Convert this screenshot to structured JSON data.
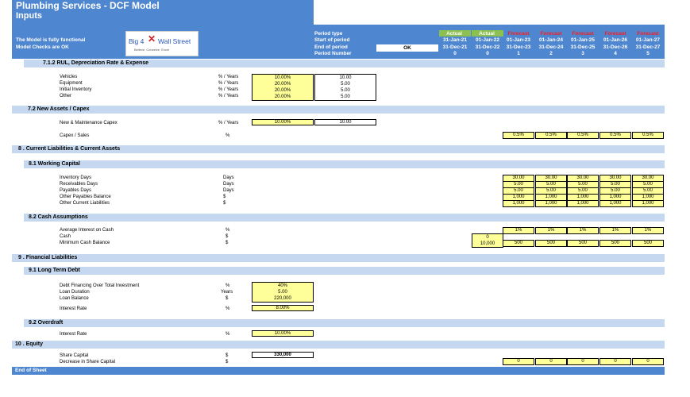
{
  "app": {
    "title": "Plumbing Services - DCF Model",
    "sheet": "Inputs",
    "status_line1": "The Model is fully functional",
    "status_line2": "Model Checks are OK",
    "ok_label": "OK",
    "logo": {
      "left": "Big 4",
      "right": "Wall Street",
      "tagline": "Believe, Conceive, Excel"
    }
  },
  "header": {
    "row_labels": [
      "Period type",
      "Start of period",
      "End of period",
      "Period Number"
    ],
    "columns": [
      {
        "type": "Actual",
        "start": "31-Jan-21",
        "end": "31-Dec-21",
        "num": "0"
      },
      {
        "type": "Actual",
        "start": "01-Jan-22",
        "end": "31-Dec-22",
        "num": "0"
      },
      {
        "type": "Forecast",
        "start": "01-Jan-23",
        "end": "31-Dec-23",
        "num": "1"
      },
      {
        "type": "Forecast",
        "start": "01-Jan-24",
        "end": "31-Dec-24",
        "num": "2"
      },
      {
        "type": "Forecast",
        "start": "01-Jan-25",
        "end": "31-Dec-25",
        "num": "3"
      },
      {
        "type": "Forecast",
        "start": "01-Jan-26",
        "end": "31-Dec-26",
        "num": "4"
      },
      {
        "type": "Forecast",
        "start": "01-Jan-27",
        "end": "31-Dec-27",
        "num": "5"
      }
    ]
  },
  "sections": {
    "s712": "7.1.2 RUL, Depreciation Rate & Expense",
    "s72": "7.2  New Assets / Capex",
    "s8": "8 . Current Liabilities & Current Assets",
    "s81": "8.1  Working Capital",
    "s82": "8.2  Cash Assumptions",
    "s9": "9 . Financial Liabilities",
    "s91": "9.1  Long Term Debt",
    "s92": "9.2  Overdraft",
    "s10": "10 . Equity"
  },
  "depreciation": {
    "rows": [
      {
        "label": "Vehicles",
        "unit": "% / Years",
        "rate": "10.00%",
        "years": "10.00"
      },
      {
        "label": "Equipment",
        "unit": "% / Years",
        "rate": "20.00%",
        "years": "5.00"
      },
      {
        "label": "Initial Inventory",
        "unit": "% / Years",
        "rate": "20.00%",
        "years": "5.00"
      },
      {
        "label": "Other",
        "unit": "% / Years",
        "rate": "20.00%",
        "years": "5.00"
      }
    ]
  },
  "capex": {
    "new_label": "New & Maintenance Capex",
    "new_unit": "% / Years",
    "new_rate": "10.00%",
    "new_years": "10.00",
    "sales_label": "Capex / Sales",
    "sales_unit": "%",
    "sales_values": [
      "0.5%",
      "0.5%",
      "0.5%",
      "0.5%",
      "0.5%"
    ]
  },
  "working_capital": {
    "labels": [
      "Inventory Days",
      "Receivables Days",
      "Payables Days",
      "Other Payables Balance",
      "Other Current Liabilities"
    ],
    "units": [
      "Days",
      "Days",
      "Days",
      "$",
      "$"
    ],
    "columns": [
      [
        "30.00",
        "5.00",
        "5.00",
        "1,000",
        "1,000"
      ],
      [
        "30.00",
        "5.00",
        "5.00",
        "1,000",
        "1,000"
      ],
      [
        "30.00",
        "5.00",
        "5.00",
        "1,000",
        "1,000"
      ],
      [
        "30.00",
        "5.00",
        "5.00",
        "1,000",
        "1,000"
      ],
      [
        "30.00",
        "5.00",
        "5.00",
        "1,000",
        "1,000"
      ]
    ]
  },
  "cash": {
    "interest_label": "Average Interest on Cash",
    "interest_unit": "%",
    "interest_values": [
      "1%",
      "1%",
      "1%",
      "1%",
      "1%"
    ],
    "cash_label": "Cash",
    "cash_unit": "$",
    "cash_actual": "0",
    "min_label": "Minimum Cash Balance",
    "min_unit": "$",
    "min_actual": "10,000",
    "min_values": [
      "500",
      "500",
      "500",
      "500",
      "500"
    ]
  },
  "debt": {
    "labels": [
      "Debt Financing Over Total Investment",
      "Loan Duration",
      "Loan Balance"
    ],
    "units": [
      "%",
      "Years",
      "$"
    ],
    "values": [
      "40%",
      "5.00",
      "220,000"
    ],
    "interest_label": "Interest Rate",
    "interest_unit": "%",
    "interest_value": "8.00%"
  },
  "overdraft": {
    "interest_label": "Interest Rate",
    "interest_unit": "%",
    "interest_value": "10.00%"
  },
  "equity": {
    "share_label": "Share Capital",
    "share_unit": "$",
    "share_value": "330,000",
    "decrease_label": "Decrease in Share Capital",
    "decrease_unit": "$",
    "decrease_values": [
      "0",
      "0",
      "0",
      "0",
      "0"
    ]
  },
  "footer": {
    "end": "End of Sheet"
  }
}
